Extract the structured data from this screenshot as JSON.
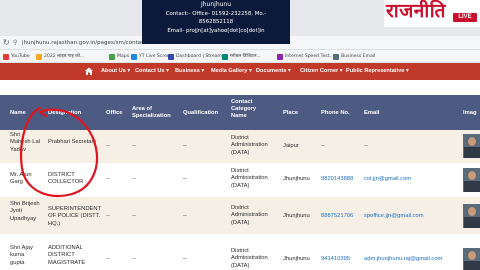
{
  "overlay": {
    "line1": "Jhunjhunu",
    "line2": "Contact:- Office- 01592-232258, Mo.-",
    "line3": "8562852118",
    "line4": "Email- projjn[at]yahoo[dot]co[dot]in"
  },
  "logo": {
    "name": "राजनीति",
    "badge": "LIVE"
  },
  "browser": {
    "url": "jhunjhunu.rajasthan.gov.in/pages/sm/contact-direc",
    "bookmarks": [
      {
        "label": "YouTube",
        "color": "#e53935"
      },
      {
        "label": "2022 लाइव गाइ को...",
        "color": "#f9a825"
      },
      {
        "label": "Maps",
        "color": "#43a047"
      },
      {
        "label": "YT Live Scren",
        "color": "#1e88e5"
      },
      {
        "label": "Dashboard | Stream...",
        "color": "#3949ab"
      },
      {
        "label": "ग्लोबल डिजिटल...",
        "color": "#00897b"
      },
      {
        "label": "Internet Speed Test...",
        "color": "#8e24aa"
      },
      {
        "label": "Business Email",
        "color": "#546e7a"
      }
    ]
  },
  "nav": {
    "items": [
      "About Us",
      "Contact Us",
      "Business",
      "Media Gallery",
      "Documents",
      "Citizen Corner",
      "Public Representative"
    ]
  },
  "table": {
    "headers": {
      "name": "Name",
      "designation": "Designation",
      "office": "Office",
      "area": "Area of Specialization",
      "qualification": "Qualification",
      "contact_category": "Contact Category Name",
      "place": "Place",
      "phone": "Phone No.",
      "email": "Email",
      "image": "Imag"
    },
    "rows": [
      {
        "name": "Shri Mahesh Lal Yadav",
        "designation": "Prabhari Secretary",
        "office": "--",
        "area": "--",
        "qualification": "--",
        "category": "District Administration (DATA)",
        "place": "Jaipur",
        "phone": "--",
        "email": "--"
      },
      {
        "name": "Mr. Arun Garg",
        "designation": "DISTRICT COLLECTOR",
        "office": "--",
        "area": "--",
        "qualification": "--",
        "category": "District Administration (DATA)",
        "place": "Jhunjhunu",
        "phone": "9829143888",
        "email": "col.jjn@gmail.com"
      },
      {
        "name": "Shri Brijesh Jyoti Upadhyay",
        "designation": "SUPERINTENDENT OF POLICE (DISTT. HQ.)",
        "office": "--",
        "area": "--",
        "qualification": "--",
        "category": "District Administration (DATA)",
        "place": "Jhunjhunu",
        "phone": "8887521706",
        "email": "spoffice.jjn@gmail.com"
      },
      {
        "name": "Shri Ajay kuma gupta",
        "designation": "ADDITIONAL DISTRICT MAGISTRATE",
        "office": "--",
        "area": "--",
        "qualification": "--",
        "category": "District Administration (DATA)",
        "place": "Jhunjhunu",
        "phone": "941410395",
        "email": "adm.jhunjhunu.raj@gmail.com"
      }
    ]
  },
  "colors": {
    "nav_bg": "#c0392b",
    "header_bg": "#4d5b82",
    "alt_row": "#f6efe6",
    "link": "#1a6fc2",
    "annotation": "#e0141e"
  }
}
